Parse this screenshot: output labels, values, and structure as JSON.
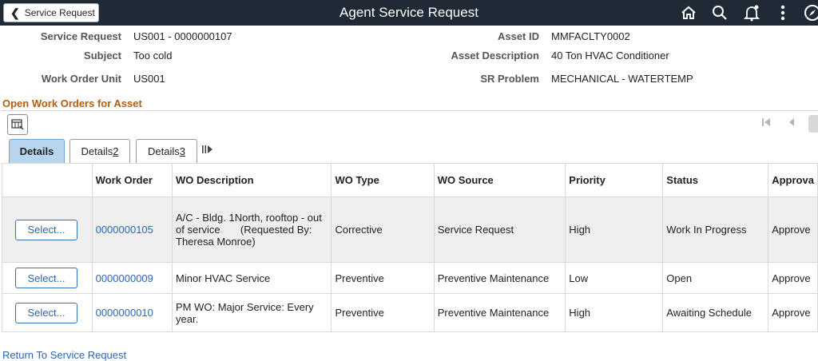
{
  "header": {
    "back_label": "Service Request",
    "title": "Agent Service Request"
  },
  "info": {
    "service_request_label": "Service Request",
    "service_request_value": "US001 - 0000000107",
    "subject_label": "Subject",
    "subject_value": "Too cold",
    "work_order_unit_label": "Work Order Unit",
    "work_order_unit_value": "US001",
    "asset_id_label": "Asset ID",
    "asset_id_value": "MMFACLTY0002",
    "asset_desc_label": "Asset Description",
    "asset_desc_value": "40 Ton HVAC Conditioner",
    "sr_problem_label": "SR Problem",
    "sr_problem_value": "MECHANICAL - WATERTEMP"
  },
  "section_title": "Open Work Orders for Asset",
  "tabs": {
    "details": "Details",
    "details2_prefix": "Details ",
    "details2_num": "2",
    "details3_prefix": "Details ",
    "details3_num": "3"
  },
  "table": {
    "headers": [
      "",
      "Work Order",
      "WO Description",
      "WO Type",
      "WO Source",
      "Priority",
      "Status",
      "Approva"
    ],
    "select_label": "Select...",
    "rows": [
      {
        "wo": "0000000105",
        "desc": "A/C - Bldg. 1North, rooftop - out of service       (Requested By: Theresa Monroe)",
        "type": "Corrective",
        "source": "Service Request",
        "priority": "High",
        "status": "Work In Progress",
        "approval": "Approve"
      },
      {
        "wo": "0000000009",
        "desc": "Minor HVAC Service",
        "type": "Preventive",
        "source": "Preventive Maintenance",
        "priority": "Low",
        "status": "Open",
        "approval": "Approve"
      },
      {
        "wo": "0000000010",
        "desc": "PM WO: Major Service: Every year.",
        "type": "Preventive",
        "source": "Preventive Maintenance",
        "priority": "High",
        "status": "Awaiting Schedule",
        "approval": "Approve"
      }
    ]
  },
  "return_link": "Return To Service Request",
  "colors": {
    "topbar": "#1f2a36",
    "accent_orange": "#b35e10",
    "link_blue": "#2b66b8",
    "tab_active": "#b8d6f0"
  }
}
